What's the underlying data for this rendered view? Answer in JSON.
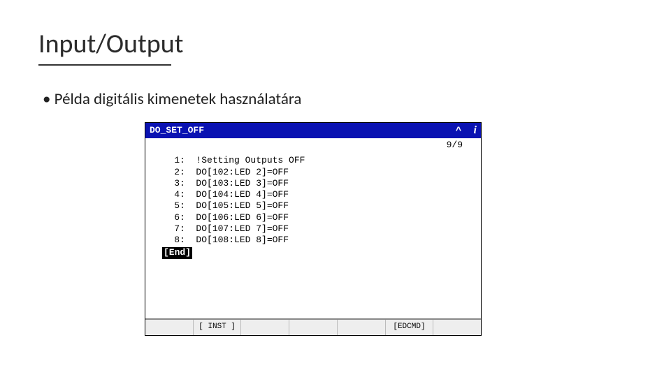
{
  "slide": {
    "title": "Input/Output",
    "bullet": "Példa digitális kimenetek használatára"
  },
  "pendant": {
    "program_name": "DO_SET_OFF",
    "info_symbol": "i",
    "caret_symbol": "^",
    "line_counter": "9/9",
    "lines": [
      {
        "n": "1:",
        "text": "  !Setting Outputs OFF"
      },
      {
        "n": "2:",
        "text": "  DO[102:LED 2]=OFF"
      },
      {
        "n": "3:",
        "text": "  DO[103:LED 3]=OFF"
      },
      {
        "n": "4:",
        "text": "  DO[104:LED 4]=OFF"
      },
      {
        "n": "5:",
        "text": "  DO[105:LED 5]=OFF"
      },
      {
        "n": "6:",
        "text": "  DO[106:LED 6]=OFF"
      },
      {
        "n": "7:",
        "text": "  DO[107:LED 7]=OFF"
      },
      {
        "n": "8:",
        "text": "  DO[108:LED 8]=OFF"
      }
    ],
    "end_label": "[End]",
    "softkeys": [
      "",
      "[ INST ]",
      "",
      "",
      "",
      "[EDCMD]",
      ""
    ]
  }
}
